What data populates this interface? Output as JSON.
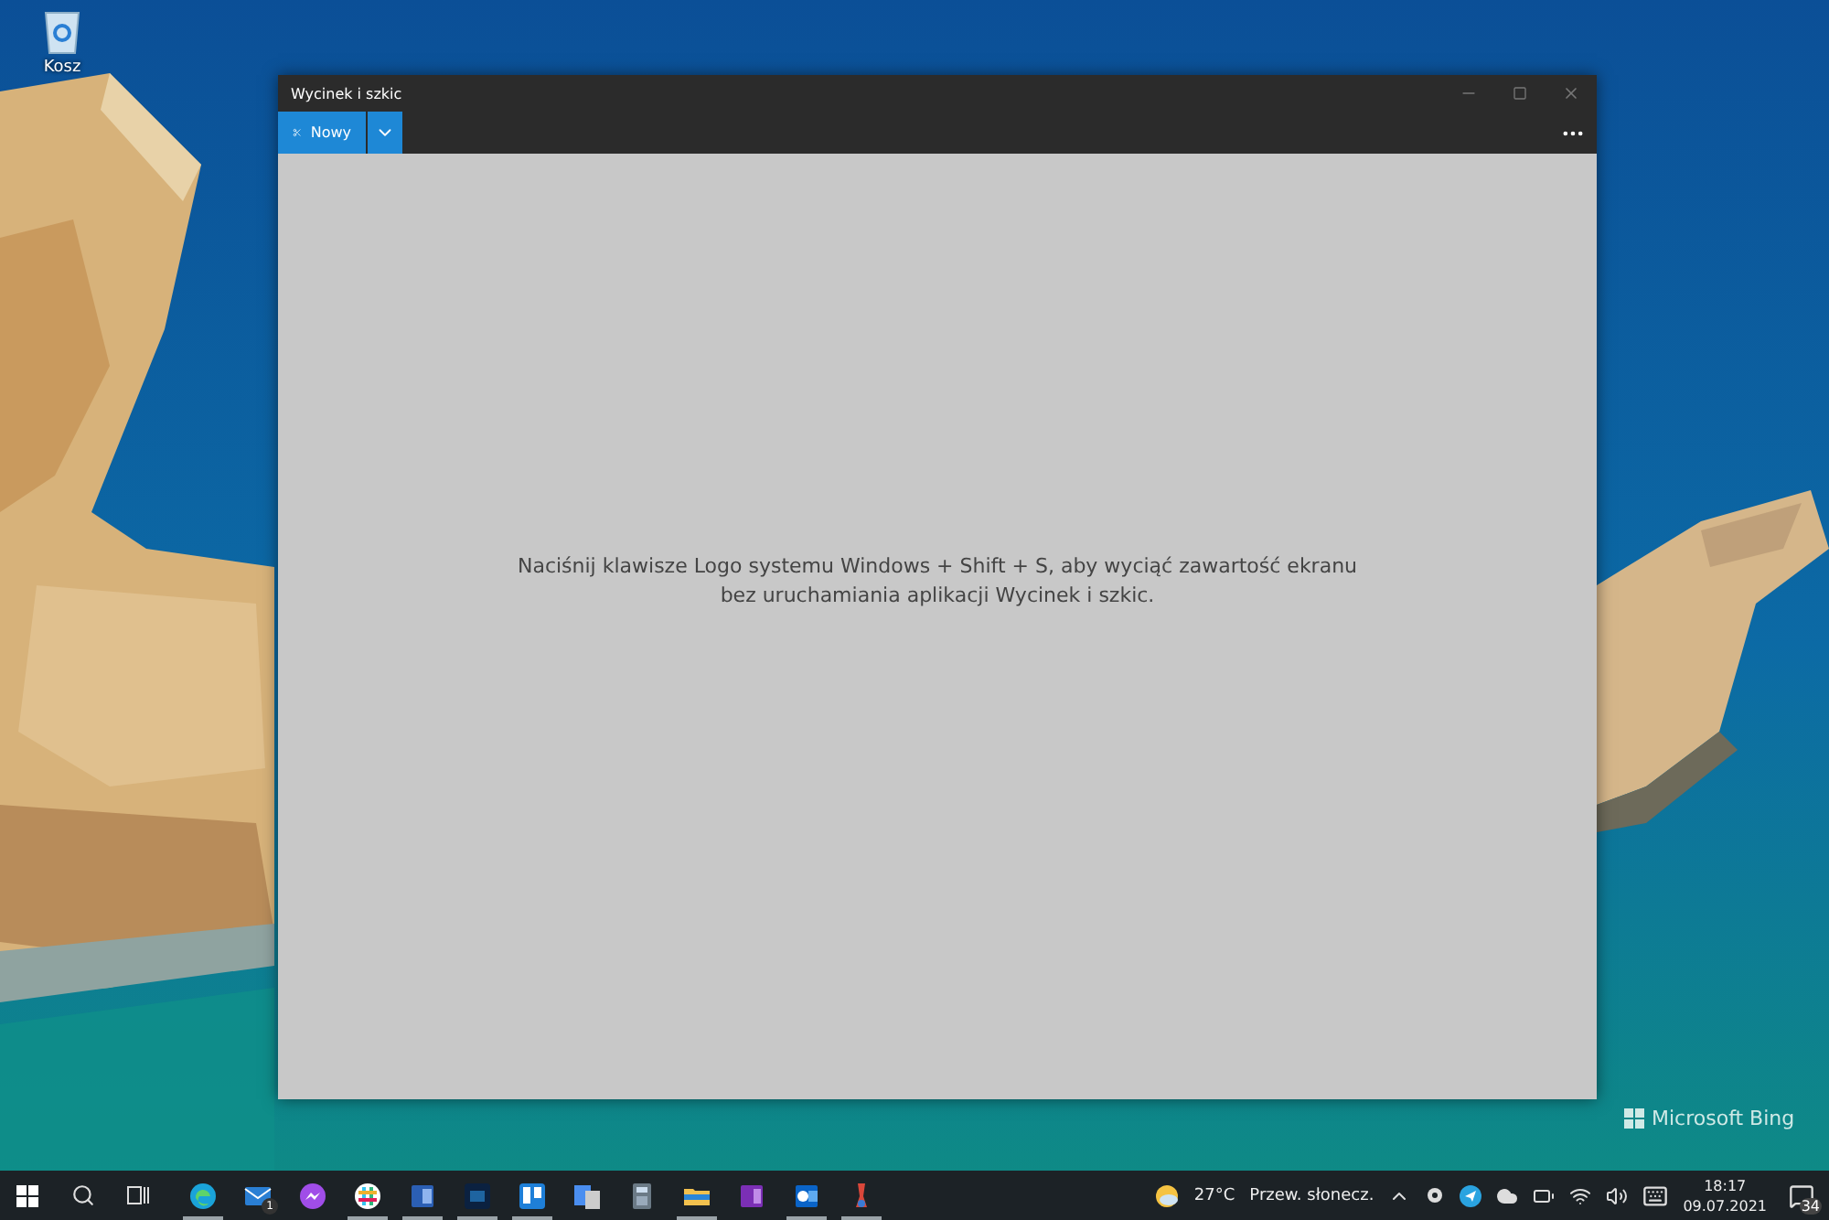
{
  "desktop": {
    "icons": [
      {
        "label": "Kosz"
      }
    ],
    "branding": "Microsoft Bing"
  },
  "window": {
    "title": "Wycinek i szkic",
    "new_button": "Nowy",
    "message": "Naciśnij klawisze Logo systemu Windows + Shift + S, aby wyciąć zawartość ekranu bez uruchamiania aplikacji Wycinek i szkic."
  },
  "taskbar": {
    "apps": [
      {
        "kind": "browser",
        "running": true
      },
      {
        "kind": "mail",
        "running": false,
        "badge": "1"
      },
      {
        "kind": "chat",
        "running": false
      },
      {
        "kind": "hashtag",
        "running": true
      },
      {
        "kind": "document",
        "running": true
      },
      {
        "kind": "image-editor",
        "running": true
      },
      {
        "kind": "board",
        "running": true
      },
      {
        "kind": "translate",
        "running": false
      },
      {
        "kind": "calculator",
        "running": false
      },
      {
        "kind": "folder",
        "running": true
      },
      {
        "kind": "notebook",
        "running": false
      },
      {
        "kind": "envelope",
        "running": true
      },
      {
        "kind": "tool",
        "running": true
      }
    ],
    "weather": {
      "temperature": "27°C",
      "condition": "Przew. słonecz."
    },
    "clock": {
      "time": "18:17",
      "date": "09.07.2021"
    },
    "notifications": {
      "count": "34"
    }
  }
}
